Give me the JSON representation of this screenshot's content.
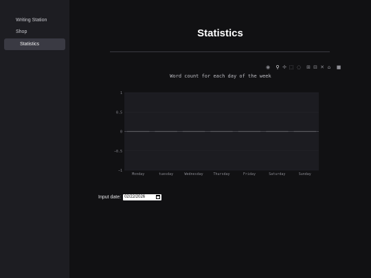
{
  "sidebar": {
    "items": [
      {
        "label": "Writing Station",
        "active": false
      },
      {
        "label": "Shop",
        "active": false
      },
      {
        "label": "Statistics",
        "active": true
      }
    ]
  },
  "page": {
    "title": "Statistics"
  },
  "modebar": {
    "icons": [
      "camera-icon",
      "zoom-icon",
      "pan-icon",
      "box-select-icon",
      "lasso-icon",
      "zoom-in-icon",
      "zoom-out-icon",
      "autoscale-icon",
      "home-icon",
      "logo-icon"
    ]
  },
  "chart_data": {
    "type": "bar",
    "title": "Word count for each day of the week",
    "categories": [
      "Monday",
      "tuesday",
      "Wednesday",
      "Thursday",
      "Friday",
      "Saturday",
      "Sunday"
    ],
    "values": [
      0,
      0,
      0,
      0,
      0,
      0,
      0
    ],
    "ylim": [
      -1,
      1
    ],
    "yticks": [
      "1",
      "0.5",
      "0",
      "−0.5",
      "−1"
    ],
    "ytick_values": [
      1,
      0.5,
      0,
      -0.5,
      -1
    ],
    "grid": true,
    "colors": {
      "plot_bg": "#1c1c21",
      "bar": "#5a5a60",
      "zero_line": "#4a4a50"
    }
  },
  "date_input": {
    "label": "Input date:",
    "value": "02/22/2026"
  }
}
